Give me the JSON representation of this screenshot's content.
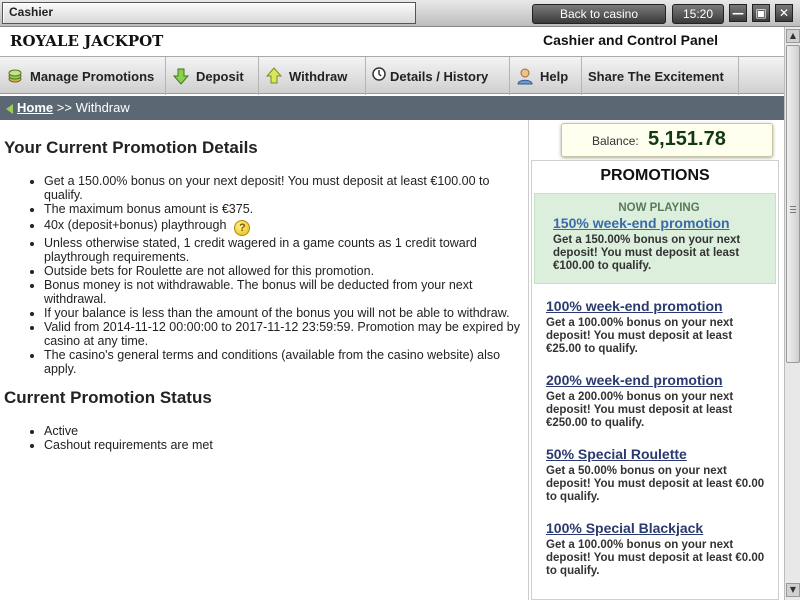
{
  "window": {
    "title": "Cashier",
    "back_button": "Back to casino",
    "clock": "15:20",
    "minimize": "—",
    "maximize": "▣",
    "close": "✕"
  },
  "header": {
    "brand": "ROYALE JACKPOT",
    "panel_title": "Cashier and Control Panel"
  },
  "nav": [
    {
      "label": "Manage Promotions",
      "icon": "coins-icon"
    },
    {
      "label": "Deposit",
      "icon": "arrow-down-icon"
    },
    {
      "label": "Withdraw",
      "icon": "arrow-up-icon"
    },
    {
      "label": "Details / History",
      "icon": "clock-icon"
    },
    {
      "label": "Help",
      "icon": "user-help-icon"
    },
    {
      "label": "Share The Excitement",
      "icon": ""
    }
  ],
  "breadcrumb": {
    "home": "Home",
    "separator": ">>",
    "current": "Withdraw"
  },
  "main": {
    "details_title": "Your Current Promotion Details",
    "details": [
      "Get a 150.00% bonus on your next deposit! You must deposit at least €100.00 to qualify.",
      "The maximum bonus amount is €375.",
      "40x (deposit+bonus) playthrough",
      "Unless otherwise stated, 1 credit wagered in a game counts as 1 credit toward playthrough requirements.",
      "Outside bets for Roulette are not allowed for this promotion.",
      "Bonus money is not withdrawable. The bonus will be deducted from your next withdrawal.",
      "If your balance is less than the amount of the bonus you will not be able to withdraw.",
      "Valid from 2014-11-12 00:00:00 to 2017-11-12 23:59:59. Promotion may be expired by casino at any time.",
      "The casino's general terms and conditions (available from the casino website) also apply."
    ],
    "help_glyph": "?",
    "status_title": "Current Promotion Status",
    "status": [
      "Active",
      "Cashout requirements are met"
    ]
  },
  "sidebar": {
    "balance_label": "Balance:",
    "balance_value": "5,151.78",
    "promotions_title": "PROMOTIONS",
    "now_playing": "NOW PLAYING",
    "promos": [
      {
        "title": "150% week-end promotion",
        "desc": "Get a 150.00% bonus on your next deposit! You must deposit at least €100.00 to qualify.",
        "active": true
      },
      {
        "title": "100% week-end promotion",
        "desc": "Get a 100.00% bonus on your next deposit! You must deposit at least €25.00 to qualify.",
        "active": false
      },
      {
        "title": "200% week-end promotion",
        "desc": "Get a 200.00% bonus on your next deposit! You must deposit at least €250.00 to qualify.",
        "active": false
      },
      {
        "title": "50% Special Roulette",
        "desc": "Get a 50.00% bonus on your next deposit! You must deposit at least €0.00 to qualify.",
        "active": false
      },
      {
        "title": "100% Special Blackjack",
        "desc": "Get a 100.00% bonus on your next deposit! You must deposit at least €0.00 to qualify.",
        "active": false
      }
    ]
  },
  "colors": {
    "breadcrumb_bg": "#5b6772",
    "active_promo_bg": "#dceedc",
    "promo_link": "#2a3a70",
    "balance_text": "#113a11"
  }
}
